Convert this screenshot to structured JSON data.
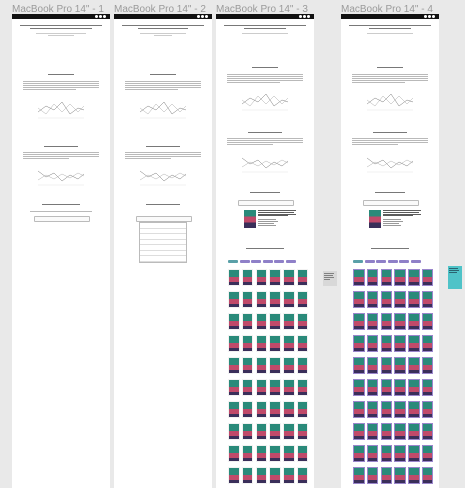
{
  "frames": [
    {
      "label": "MacBook Pro 14\" - 1"
    },
    {
      "label": "MacBook Pro 14\" - 2"
    },
    {
      "label": "MacBook Pro 14\" - 3"
    },
    {
      "label": "MacBook Pro 14\" - 4"
    }
  ],
  "colors": {
    "canvas": "#e9e9e9",
    "frame": "#ffffff",
    "topbar": "#111111",
    "genre_tag": "#8f80c8",
    "book_tint": "#9a86cc",
    "note_gray": "#d8d8d8",
    "note_teal": "#4fc3c8"
  }
}
